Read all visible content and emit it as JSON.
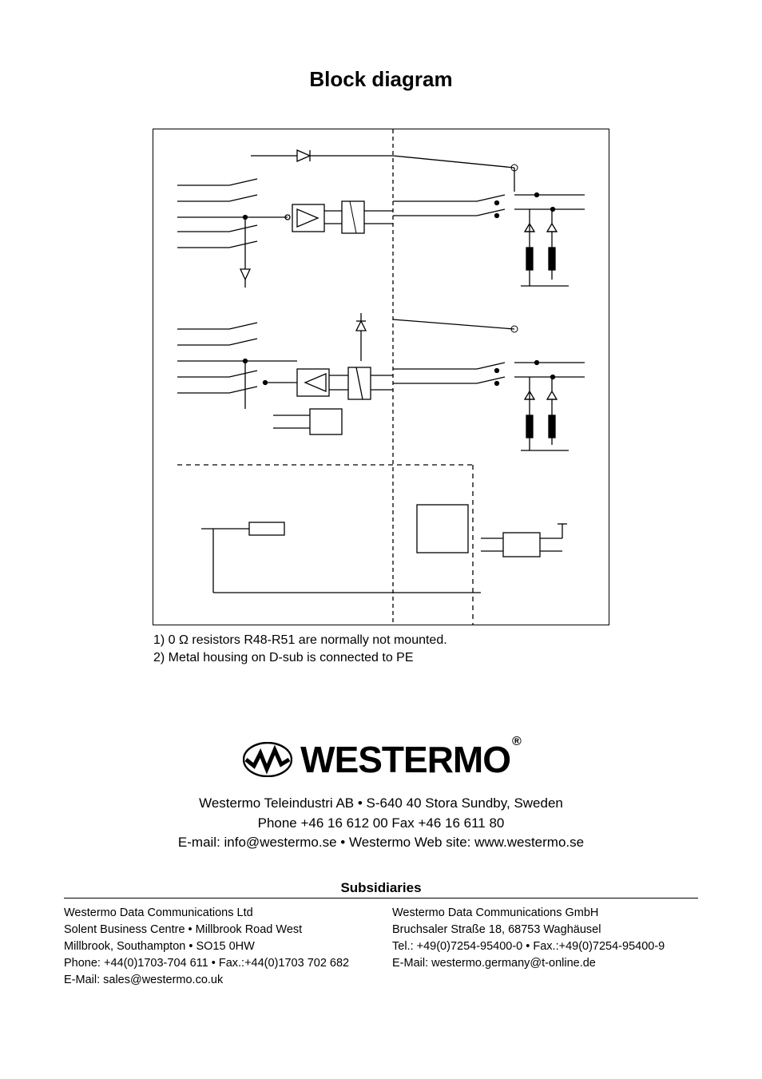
{
  "title": "Block diagram",
  "notes": {
    "n1": "1)  0 Ω resistors R48-R51 are normally not mounted.",
    "n2": "2)  Metal housing on D-sub is connected to PE"
  },
  "brand": {
    "name": "Westermo",
    "reg": "®"
  },
  "hq": {
    "line1": "Westermo Teleindustri AB • S-640 40 Stora Sundby, Sweden",
    "line2": "Phone +46 16 612 00  Fax +46 16 611 80",
    "line3": "E-mail: info@westermo.se • Westermo Web site: www.westermo.se"
  },
  "subs_heading": "Subsidiaries",
  "sub_uk": {
    "name": "Westermo Data Communications Ltd",
    "addr1": "Solent Business Centre • Millbrook Road West",
    "addr2": "Millbrook, Southampton • SO15 0HW",
    "phone": "Phone:  +44(0)1703-704 611 • Fax.:+44(0)1703 702 682",
    "email": "E-Mail: sales@westermo.co.uk"
  },
  "sub_de": {
    "name": "Westermo Data Communications GmbH",
    "addr1": "Bruchsaler Straße 18, 68753 Waghäusel",
    "phone": "Tel.: +49(0)7254-95400-0 • Fax.:+49(0)7254-95400-9",
    "email": "E-Mail: westermo.germany@t-online.de"
  }
}
